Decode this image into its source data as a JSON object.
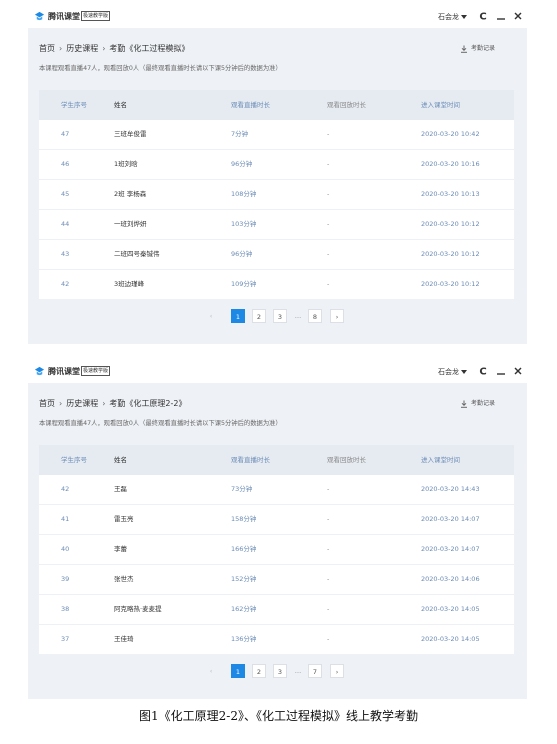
{
  "windows": [
    {
      "app_name": "腾讯课堂",
      "edition_badge": "极速教学版",
      "user_name": "石会龙",
      "buttons": {
        "refresh": "C",
        "minimize": "—",
        "close": "×"
      },
      "breadcrumb": {
        "home": "首页",
        "category": "历史课程",
        "page": "考勤《化工过程模拟》"
      },
      "export_label": "考勤记录",
      "notice": "本课程观看直播47人，观看回放0人（最终观看直播时长请以下课5分钟后的数据为准）",
      "table": {
        "headers": [
          "学生序号",
          "姓名",
          "观看直播时长",
          "观看回放时长",
          "进入课堂时间"
        ],
        "rows": [
          [
            "47",
            "三班牟俊雷",
            "7分钟",
            "-",
            "2020-03-20 10:42"
          ],
          [
            "46",
            "1班刘晗",
            "96分钟",
            "-",
            "2020-03-20 10:16"
          ],
          [
            "45",
            "2班 李杨森",
            "108分钟",
            "-",
            "2020-03-20 10:13"
          ],
          [
            "44",
            "一班刘烨妍",
            "103分钟",
            "-",
            "2020-03-20 10:12"
          ],
          [
            "43",
            "二班四号秦铖伟",
            "96分钟",
            "-",
            "2020-03-20 10:12"
          ],
          [
            "42",
            "3班边瑾峰",
            "109分钟",
            "-",
            "2020-03-20 10:12"
          ]
        ]
      },
      "pagination": {
        "prev": "‹",
        "pages": [
          "1",
          "2",
          "3"
        ],
        "ellipsis": "…",
        "last": "8",
        "next": "›",
        "current": "1"
      }
    },
    {
      "app_name": "腾讯课堂",
      "edition_badge": "极速教学版",
      "user_name": "石会龙",
      "buttons": {
        "refresh": "C",
        "minimize": "—",
        "close": "×"
      },
      "breadcrumb": {
        "home": "首页",
        "category": "历史课程",
        "page": "考勤《化工原理2-2》"
      },
      "export_label": "考勤记录",
      "notice": "本课程观看直播47人，观看回放0人（最终观看直播时长请以下课5分钟后的数据为准）",
      "table": {
        "headers": [
          "学生序号",
          "姓名",
          "观看直播时长",
          "观看回放时长",
          "进入课堂时间"
        ],
        "rows": [
          [
            "42",
            "王磊",
            "73分钟",
            "-",
            "2020-03-20 14:43"
          ],
          [
            "41",
            "雷玉亮",
            "158分钟",
            "-",
            "2020-03-20 14:07"
          ],
          [
            "40",
            "李蕾",
            "166分钟",
            "-",
            "2020-03-20 14:07"
          ],
          [
            "39",
            "张世杰",
            "152分钟",
            "-",
            "2020-03-20 14:06"
          ],
          [
            "38",
            "阿克略热·麦麦提",
            "162分钟",
            "-",
            "2020-03-20 14:05"
          ],
          [
            "37",
            "王佳琦",
            "136分钟",
            "-",
            "2020-03-20 14:05"
          ]
        ]
      },
      "pagination": {
        "prev": "‹",
        "pages": [
          "1",
          "2",
          "3"
        ],
        "ellipsis": "…",
        "last": "7",
        "next": "›",
        "current": "1"
      }
    }
  ],
  "caption": "图1《化工原理2-2》、《化工过程模拟》线上教学考勤",
  "colors": {
    "accent": "#1e88e5",
    "header_bg": "#e6ebf2",
    "window_bg": "#eef1f6",
    "link_text": "#6b8bb5"
  },
  "icons": [
    "tencent-classroom-logo-icon",
    "caret-down-icon",
    "refresh-icon",
    "minimize-icon",
    "close-icon",
    "chevron-right-icon",
    "download-icon"
  ]
}
